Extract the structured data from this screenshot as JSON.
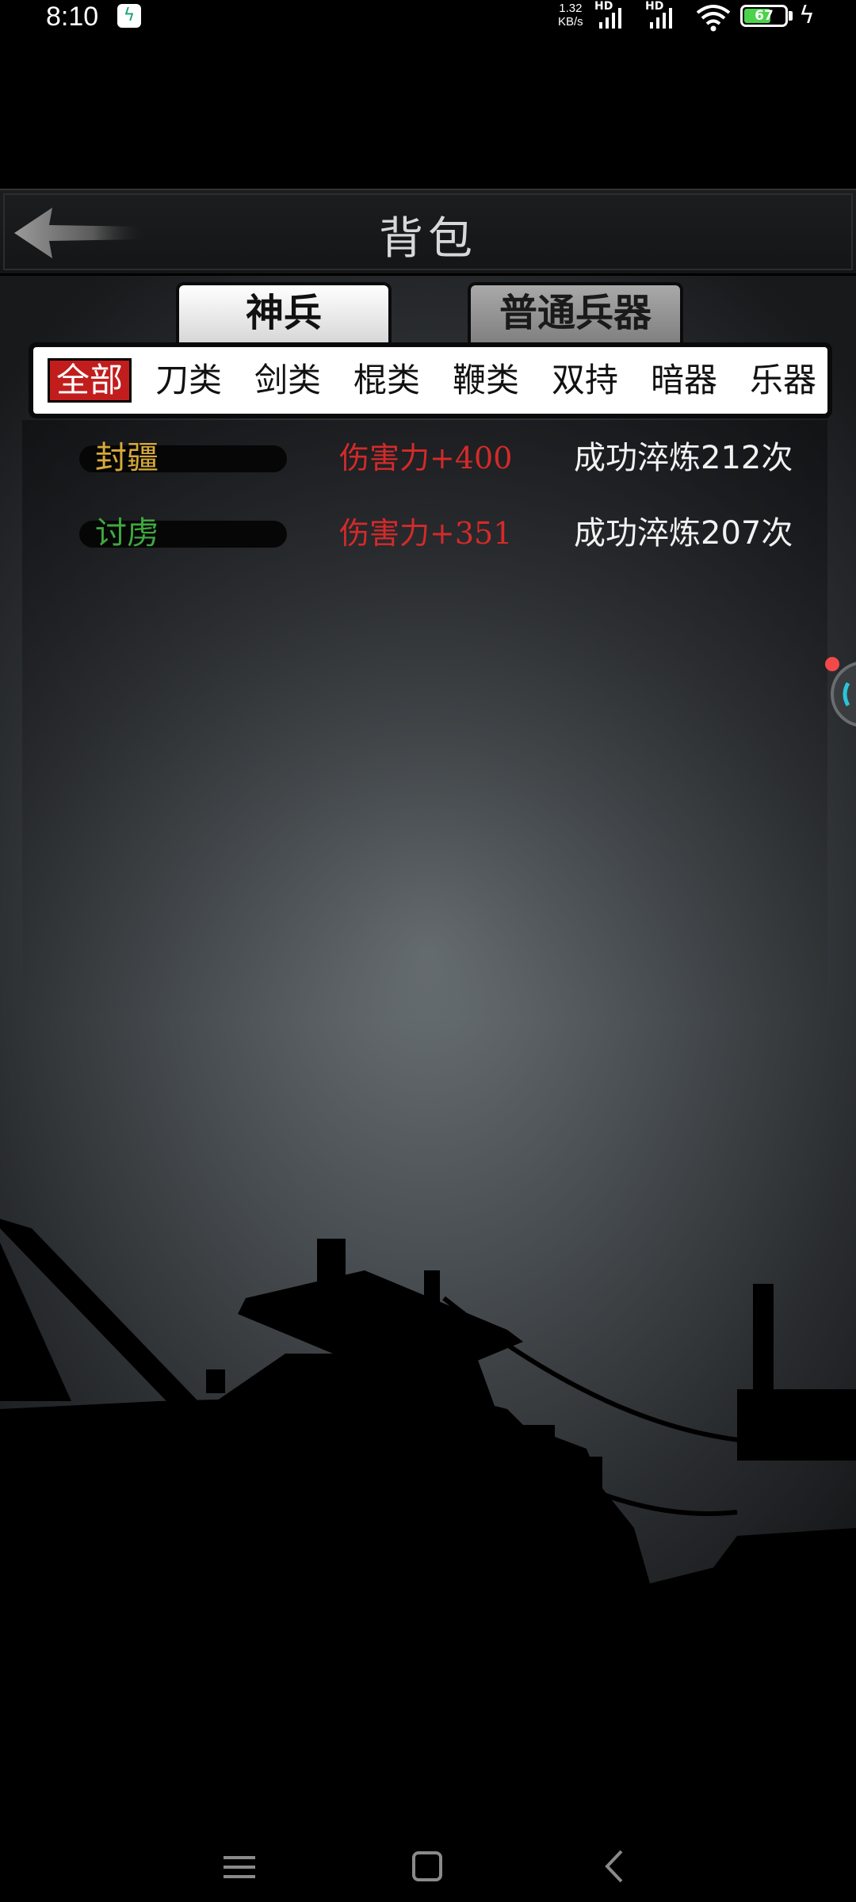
{
  "status": {
    "time": "8:10",
    "speed_top": "1.32",
    "speed_bottom": "KB/s",
    "hd1": "HD",
    "hd2": "HD",
    "battery": "67"
  },
  "header": {
    "title": "背包"
  },
  "tabs": [
    {
      "label": "神兵",
      "active": true
    },
    {
      "label": "普通兵器",
      "active": false
    }
  ],
  "filters": [
    "全部",
    "刀类",
    "剑类",
    "棍类",
    "鞭类",
    "双持",
    "暗器",
    "乐器"
  ],
  "selected_filter": "全部",
  "items": [
    {
      "name": "封疆",
      "name_color": "#d8a93a",
      "damage": "伤害力+400",
      "refine": "成功淬炼212次"
    },
    {
      "name": "讨虏",
      "name_color": "#3fa83f",
      "damage": "伤害力+351",
      "refine": "成功淬炼207次"
    }
  ],
  "colors": {
    "accent_red": "#c11d1d",
    "damage_red": "#d42a2a"
  }
}
